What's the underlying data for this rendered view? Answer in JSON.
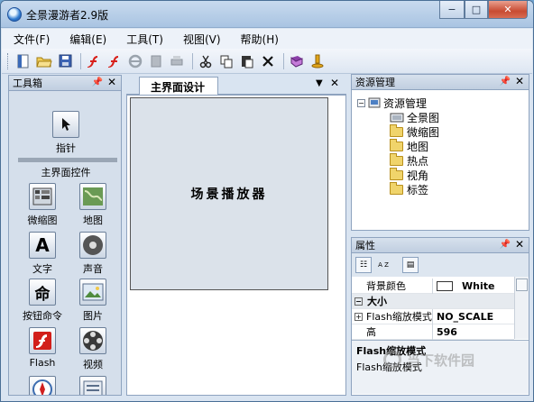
{
  "window": {
    "title": "全景漫游者2.9版",
    "minimize_label": "−",
    "maximize_label": "□",
    "close_label": "✕"
  },
  "menu": [
    "文件(F)",
    "编辑(E)",
    "工具(T)",
    "视图(V)",
    "帮助(H)"
  ],
  "toolbar": {
    "buttons": [
      "new-icon",
      "open-icon",
      "save-icon",
      "flash-red-icon",
      "flash-red-icon-2",
      "ie-icon",
      "publish-icon",
      "print-icon",
      "cut-icon",
      "copy-icon",
      "paste-icon",
      "delete-icon",
      "help-book-icon",
      "player-icon"
    ]
  },
  "toolbox": {
    "title": "工具箱",
    "pointer_label": "指针",
    "section_label": "主界面控件",
    "tools": [
      "微缩图",
      "地图",
      "文字",
      "声音",
      "按钮命令",
      "图片",
      "Flash",
      "视频"
    ],
    "text_glyph": "A",
    "command_glyph": "命"
  },
  "document": {
    "tab_label": "主界面设计",
    "canvas_text": "场景播放器"
  },
  "resource": {
    "title": "资源管理",
    "root": "资源管理",
    "items": [
      "全景图",
      "微缩图",
      "地图",
      "热点",
      "视角",
      "标签"
    ]
  },
  "properties": {
    "title": "属性",
    "sort_label": "A Z",
    "rows": [
      {
        "key": "背景颜色",
        "value": "White"
      },
      {
        "key": "大小",
        "value": ""
      },
      {
        "key": "Flash缩放模式",
        "value": "NO_SCALE"
      },
      {
        "key": "高",
        "value": "596"
      }
    ],
    "desc_title": "Flash缩放模式",
    "desc_text": "Flash缩放模式"
  },
  "watermark": "当下软件园"
}
